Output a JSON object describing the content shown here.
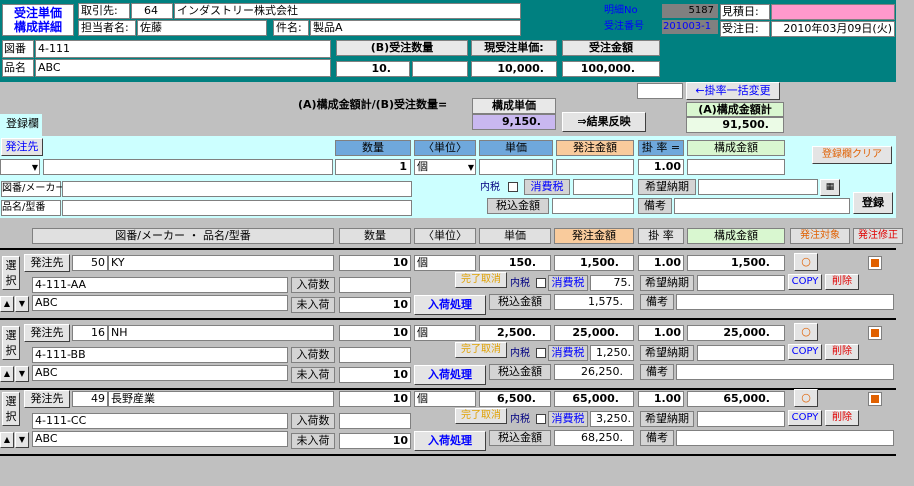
{
  "header": {
    "title1": "受注単価",
    "title2": "構成詳細",
    "torihiki_label": "取引先:",
    "torihiki_code": "64",
    "torihiki_name": "インダストリー株式会社",
    "tanto_label": "担当者名:",
    "tanto_value": "佐藤",
    "kenmei_label": "件名:",
    "kenmei_value": "製品A",
    "meisai_label": "明細No",
    "meisai_value": "5187",
    "juchu_no_label": "受注番号",
    "juchu_no_value": "201003-1",
    "mitsumori_label": "見積日:",
    "mitsumori_value": "",
    "juchu_date_label": "受注日:",
    "juchu_date_value": "2010年03月09日(火)",
    "zuban_label": "図番",
    "zuban_value": "4-111",
    "hinmei_label": "品名",
    "hinmei_value": "ABC",
    "qty_label": "(B)受注数量",
    "qty_value": "10.",
    "price_label": "現受注単価:",
    "price_value": "10,000.",
    "amount_label": "受注金額",
    "amount_value": "100,000."
  },
  "summary": {
    "rate_change_button": "←掛率一括変更",
    "formula_label": "(A)構成金額計/(B)受注数量=",
    "unit_price_label": "構成単価",
    "unit_price_value": "9,150.",
    "reflect_button": "⇒結果反映",
    "total_label": "(A)構成金額計",
    "total_value": "91,500."
  },
  "entry": {
    "tab_label": "登録欄",
    "supplier_button": "発注先",
    "col_qty": "数量",
    "col_unit": "〈単位〉",
    "col_price": "単価",
    "col_order_amount": "発注金額",
    "col_rate": "掛 率 =",
    "col_comp_amount": "構成金額",
    "clear_button": "登録欄クリア",
    "qty_value": "1",
    "unit_value": "個",
    "rate_value": "1.00",
    "zuban_maker_label": "図番/メーカー",
    "hin_kata_label": "品名/型番",
    "tax_incl_label": "内税",
    "tax_label": "消費税",
    "hope_date_label": "希望納期",
    "tax_incl_amount_label": "税込金額",
    "remarks_label": "備考",
    "register_button": "登録"
  },
  "list_header": {
    "col_name": "図番/メーカー ・ 品名/型番",
    "col_qty": "数量",
    "col_unit": "〈単位〉",
    "col_price": "単価",
    "col_order_amount": "発注金額",
    "col_rate": "掛 率",
    "col_comp_amount": "構成金額",
    "col_order_target": "発注対象",
    "col_order_fix": "発注修正"
  },
  "rows": [
    {
      "select": "選択",
      "supplier_btn": "発注先",
      "code": "50",
      "supplier": "KY",
      "qty": "10",
      "unit": "個",
      "price": "150.",
      "amount": "1,500.",
      "rate": "1.00",
      "comp": "1,500.",
      "zuban": "4-111-AA",
      "hinmei": "ABC",
      "nyuka_label": "入荷数",
      "minyuka_label": "未入荷",
      "minyuka_value": "10",
      "nyuka_btn": "入荷処理",
      "done_cancel": "完了取消",
      "tax_incl": "内税",
      "tax_label": "消費税",
      "tax_value": "75.",
      "hope_label": "希望納期",
      "total_label": "税込金額",
      "total_value": "1,575.",
      "remarks_label": "備考",
      "copy": "COPY",
      "delete": "削除"
    },
    {
      "select": "選択",
      "supplier_btn": "発注先",
      "code": "16",
      "supplier": "NH",
      "qty": "10",
      "unit": "個",
      "price": "2,500.",
      "amount": "25,000.",
      "rate": "1.00",
      "comp": "25,000.",
      "zuban": "4-111-BB",
      "hinmei": "ABC",
      "nyuka_label": "入荷数",
      "minyuka_label": "未入荷",
      "minyuka_value": "10",
      "nyuka_btn": "入荷処理",
      "done_cancel": "完了取消",
      "tax_incl": "内税",
      "tax_label": "消費税",
      "tax_value": "1,250.",
      "hope_label": "希望納期",
      "total_label": "税込金額",
      "total_value": "26,250.",
      "remarks_label": "備考",
      "copy": "COPY",
      "delete": "削除"
    },
    {
      "select": "選択",
      "supplier_btn": "発注先",
      "code": "49",
      "supplier": "長野産業",
      "qty": "10",
      "unit": "個",
      "price": "6,500.",
      "amount": "65,000.",
      "rate": "1.00",
      "comp": "65,000.",
      "zuban": "4-111-CC",
      "hinmei": "ABC",
      "nyuka_label": "入荷数",
      "minyuka_label": "未入荷",
      "minyuka_value": "10",
      "nyuka_btn": "入荷処理",
      "done_cancel": "完了取消",
      "tax_incl": "内税",
      "tax_label": "消費税",
      "tax_value": "3,250.",
      "hope_label": "希望納期",
      "total_label": "税込金額",
      "total_value": "68,250.",
      "remarks_label": "備考",
      "copy": "COPY",
      "delete": "削除"
    }
  ],
  "colors": {
    "teal": "#008080",
    "title_blue": "#0000ff",
    "pink": "#ff99cc",
    "purple": "#c9b8f0",
    "blue_hdr": "#6fa8dc",
    "orange_hdr": "#f9cb9c",
    "green_hdr": "#d9f7d0",
    "entry_bg": "#ccffff"
  }
}
